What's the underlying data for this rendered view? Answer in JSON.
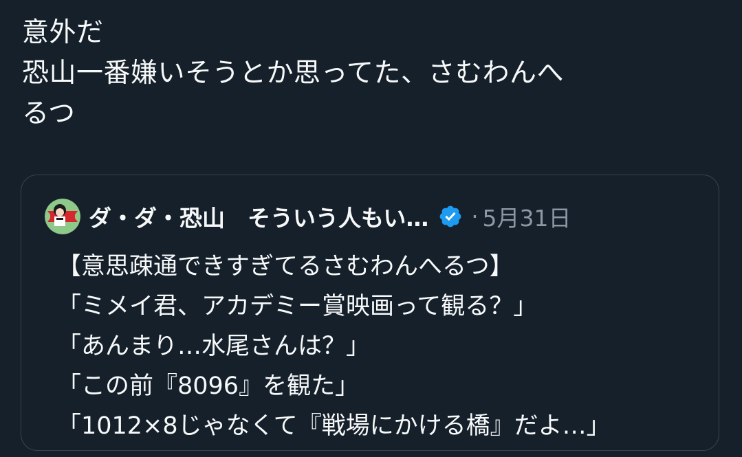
{
  "tweet": {
    "text_lines": [
      "意外だ",
      "恐山一番嫌いそうとか思ってた、さむわんへ",
      "るつ"
    ]
  },
  "quoted_tweet": {
    "display_name": "ダ・ダ・恐山　そういう人もい…",
    "verified": true,
    "separator": "·",
    "date": "5月31日",
    "body_lines": [
      "【意思疎通できすぎてるさむわんへるつ】",
      "「ミメイ君、アカデミー賞映画って観る？」",
      "「あんまり…水尾さんは？」",
      "「この前『8096』を観た」",
      "「1012×8じゃなくて『戦場にかける橋』だよ…」"
    ]
  },
  "colors": {
    "background": "#15202b",
    "text": "#f7f9f9",
    "secondary_text": "#8b98a5",
    "card_border": "#38444d",
    "verified_badge": "#1d9bf0"
  },
  "icons": {
    "avatar": "avatar-image",
    "verified": "verified-badge-icon"
  }
}
